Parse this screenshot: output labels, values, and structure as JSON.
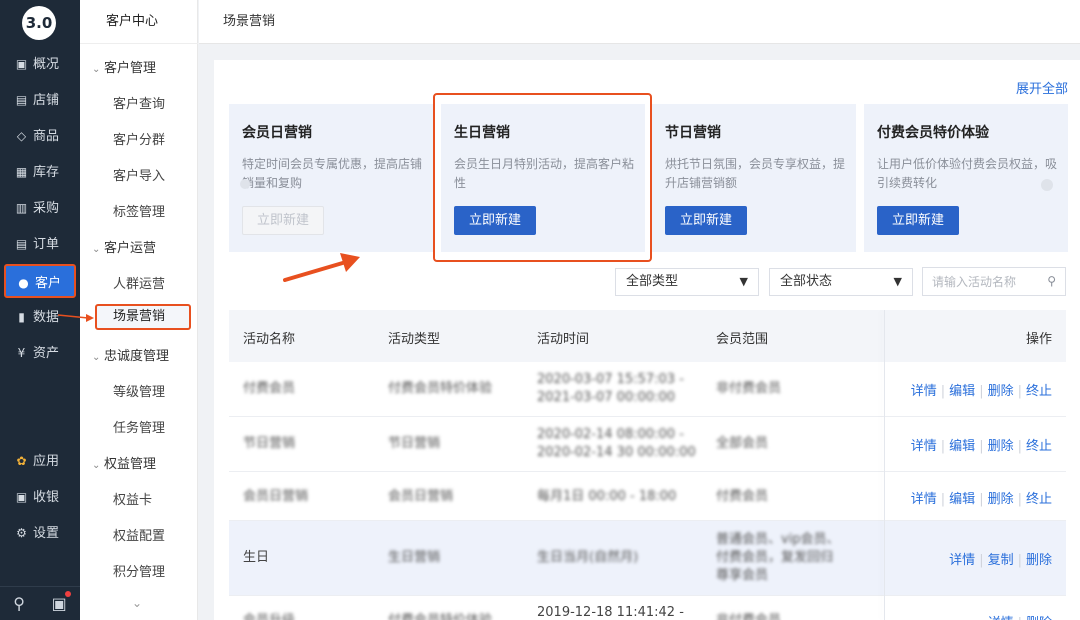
{
  "app": {
    "logo": "3.0"
  },
  "nav": {
    "items": [
      {
        "label": "概况",
        "icon": "monitor-icon",
        "glyph": "▣"
      },
      {
        "label": "店铺",
        "icon": "store-icon",
        "glyph": "▤"
      },
      {
        "label": "商品",
        "icon": "tag-icon",
        "glyph": "◇"
      },
      {
        "label": "库存",
        "icon": "warehouse-icon",
        "glyph": "▦"
      },
      {
        "label": "采购",
        "icon": "purchase-icon",
        "glyph": "▥"
      },
      {
        "label": "订单",
        "icon": "order-icon",
        "glyph": "▤"
      },
      {
        "label": "客户",
        "icon": "user-icon",
        "glyph": "●"
      },
      {
        "label": "数据",
        "icon": "chart-icon",
        "glyph": "▮"
      },
      {
        "label": "资产",
        "icon": "yen-icon",
        "glyph": "¥"
      },
      {
        "label": "应用",
        "icon": "apps-icon",
        "glyph": "✿"
      },
      {
        "label": "收银",
        "icon": "cashier-icon",
        "glyph": "▣"
      },
      {
        "label": "设置",
        "icon": "gear-icon",
        "glyph": "⚙"
      }
    ],
    "active": "客户"
  },
  "subnav": {
    "title": "客户中心",
    "groups": [
      {
        "label": "客户管理",
        "items": [
          "客户查询",
          "客户分群",
          "客户导入",
          "标签管理"
        ]
      },
      {
        "label": "客户运营",
        "items": [
          "人群运营",
          "场景营销"
        ]
      },
      {
        "label": "忠诚度管理",
        "items": [
          "等级管理",
          "任务管理"
        ]
      },
      {
        "label": "权益管理",
        "items": [
          "权益卡",
          "权益配置",
          "积分管理"
        ]
      }
    ],
    "active": "场景营销"
  },
  "header": {
    "breadcrumb": "场景营销"
  },
  "main": {
    "expand_label": "展开全部",
    "cards": [
      {
        "title": "会员日营销",
        "desc": "特定时间会员专属优惠，提高店铺销量和复购",
        "button": "立即新建",
        "disabled": true
      },
      {
        "title": "生日营销",
        "desc": "会员生日月特别活动，提高客户粘性",
        "button": "立即新建",
        "disabled": false
      },
      {
        "title": "节日营销",
        "desc": "烘托节日氛围，会员专享权益，提升店铺营销额",
        "button": "立即新建",
        "disabled": false
      },
      {
        "title": "付费会员特价体验",
        "desc": "让用户低价体验付费会员权益，吸引续费转化",
        "button": "立即新建",
        "disabled": false
      }
    ],
    "filters": {
      "type": "全部类型",
      "status": "全部状态",
      "search_placeholder": "请输入活动名称"
    },
    "table": {
      "columns": [
        "活动名称",
        "活动类型",
        "活动时间",
        "会员范围",
        "操作"
      ],
      "rows": [
        {
          "name": "付费会员",
          "type": "付费会员特价体验",
          "time": [
            "2020-03-07 15:57:03 -",
            "2021-03-07 00:00:00"
          ],
          "scope": [
            "非付费会员"
          ],
          "ops": [
            "详情",
            "编辑",
            "删除",
            "终止"
          ]
        },
        {
          "name": "节日营销",
          "type": "节日营销",
          "time": [
            "2020-02-14 08:00:00 -",
            "2020-02-14 30 00:00:00"
          ],
          "scope": [
            "全部会员"
          ],
          "ops": [
            "详情",
            "编辑",
            "删除",
            "终止"
          ]
        },
        {
          "name": "会员日营销",
          "type": "会员日营销",
          "time": [
            "每月1日 00:00 - 18:00"
          ],
          "scope": [
            "付费会员"
          ],
          "ops": [
            "详情",
            "编辑",
            "删除",
            "终止"
          ]
        },
        {
          "name": "生日",
          "type": "生日营销",
          "time": [
            "生日当月(自然月)"
          ],
          "scope": [
            "普通会员、vip会员、",
            "付费会员，复发回归",
            "尊享会员"
          ],
          "ops": [
            "详情",
            "复制",
            "删除"
          ]
        },
        {
          "name": "会员升级",
          "type": "付费会员特价体验",
          "time": [
            "2019-12-18 11:41:42 -"
          ],
          "scope": [
            "非付费会员"
          ],
          "ops": [
            "详情",
            "删除"
          ]
        }
      ]
    }
  }
}
